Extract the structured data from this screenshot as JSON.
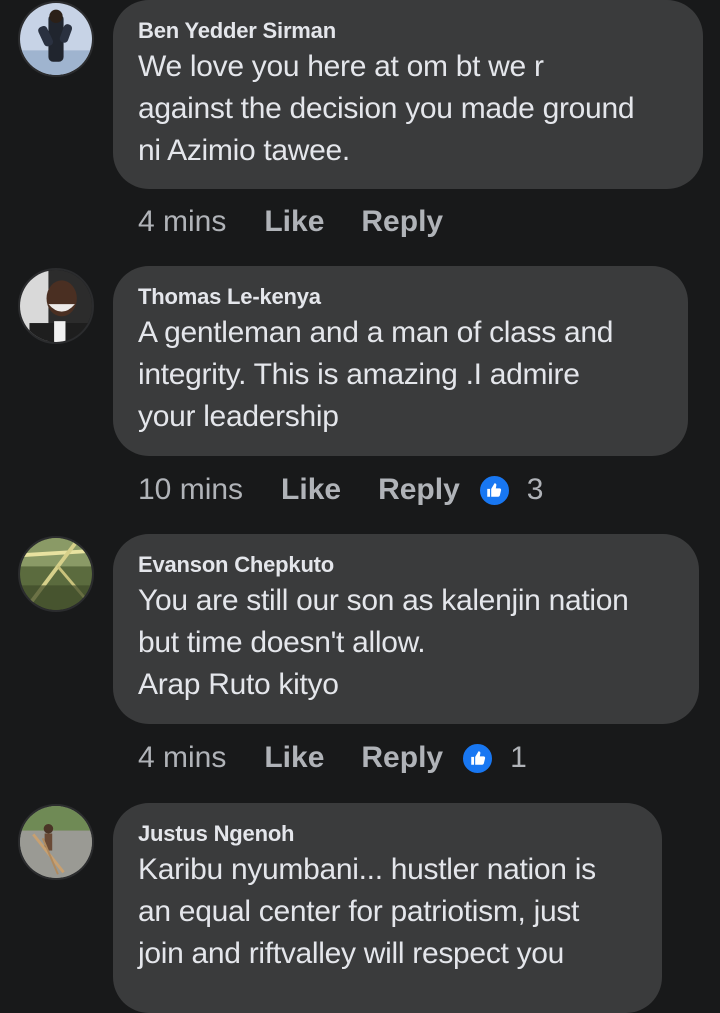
{
  "comments": [
    {
      "author": "Ben Yedder Sirman",
      "text": "We love you here at om bt we r\nagainst the decision you made ground\nni Azimio tawee.",
      "time": "4 mins",
      "like_label": "Like",
      "reply_label": "Reply",
      "reactions": ""
    },
    {
      "author": "Thomas Le-kenya",
      "text": "A gentleman  and a man of class and\nintegrity.  This is amazing .I admire\nyour leadership",
      "time": "10 mins",
      "like_label": "Like",
      "reply_label": "Reply",
      "reactions": "3"
    },
    {
      "author": "Evanson Chepkuto",
      "text": "You are still our son as kalenjin nation\nbut time doesn't allow.\nArap Ruto kityo",
      "time": "4 mins",
      "like_label": "Like",
      "reply_label": "Reply",
      "reactions": "1"
    },
    {
      "author": "Justus Ngenoh",
      "text": "Karibu nyumbani... hustler nation is\nan equal center for patriotism, just\njoin and riftvalley will respect you",
      "time": "",
      "like_label": "",
      "reply_label": "",
      "reactions": ""
    }
  ],
  "theme": {
    "background": "#18191a",
    "bubble": "#3a3b3c",
    "text_primary": "#e4e6eb",
    "text_secondary": "#b0b3b8",
    "like_blue": "#1877f2"
  },
  "icons": {
    "reaction": "thumbs-up-icon"
  }
}
